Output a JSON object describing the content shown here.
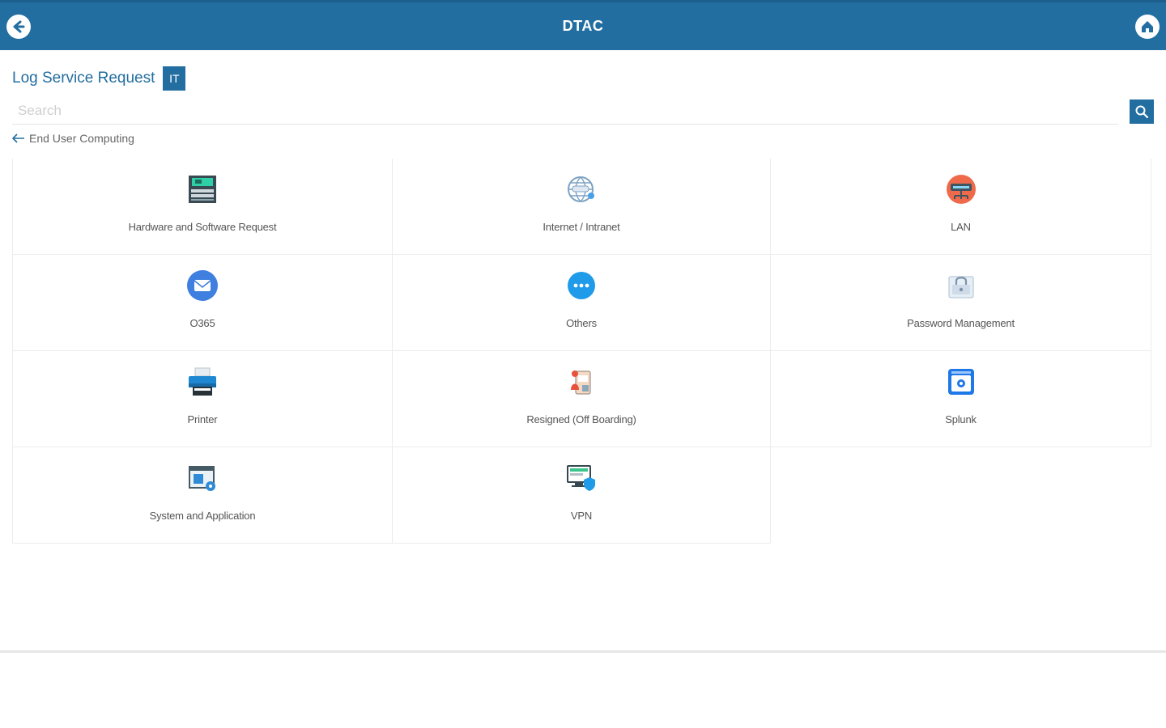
{
  "header": {
    "title": "DTAC"
  },
  "page": {
    "heading": "Log Service Request",
    "badge": "IT"
  },
  "search": {
    "placeholder": "Search"
  },
  "breadcrumb": {
    "label": "End User Computing"
  },
  "categories": [
    {
      "label": "Hardware and Software Request",
      "icon": "hardware-icon"
    },
    {
      "label": "Internet / Intranet",
      "icon": "internet-icon"
    },
    {
      "label": "LAN",
      "icon": "lan-icon"
    },
    {
      "label": "O365",
      "icon": "mail-icon"
    },
    {
      "label": "Others",
      "icon": "more-icon"
    },
    {
      "label": "Password Management",
      "icon": "password-icon"
    },
    {
      "label": "Printer",
      "icon": "printer-icon"
    },
    {
      "label": "Resigned (Off Boarding)",
      "icon": "resigned-icon"
    },
    {
      "label": "Splunk",
      "icon": "splunk-icon"
    },
    {
      "label": "System and Application",
      "icon": "system-icon"
    },
    {
      "label": "VPN",
      "icon": "vpn-icon"
    }
  ],
  "colors": {
    "primary": "#236ea1"
  }
}
